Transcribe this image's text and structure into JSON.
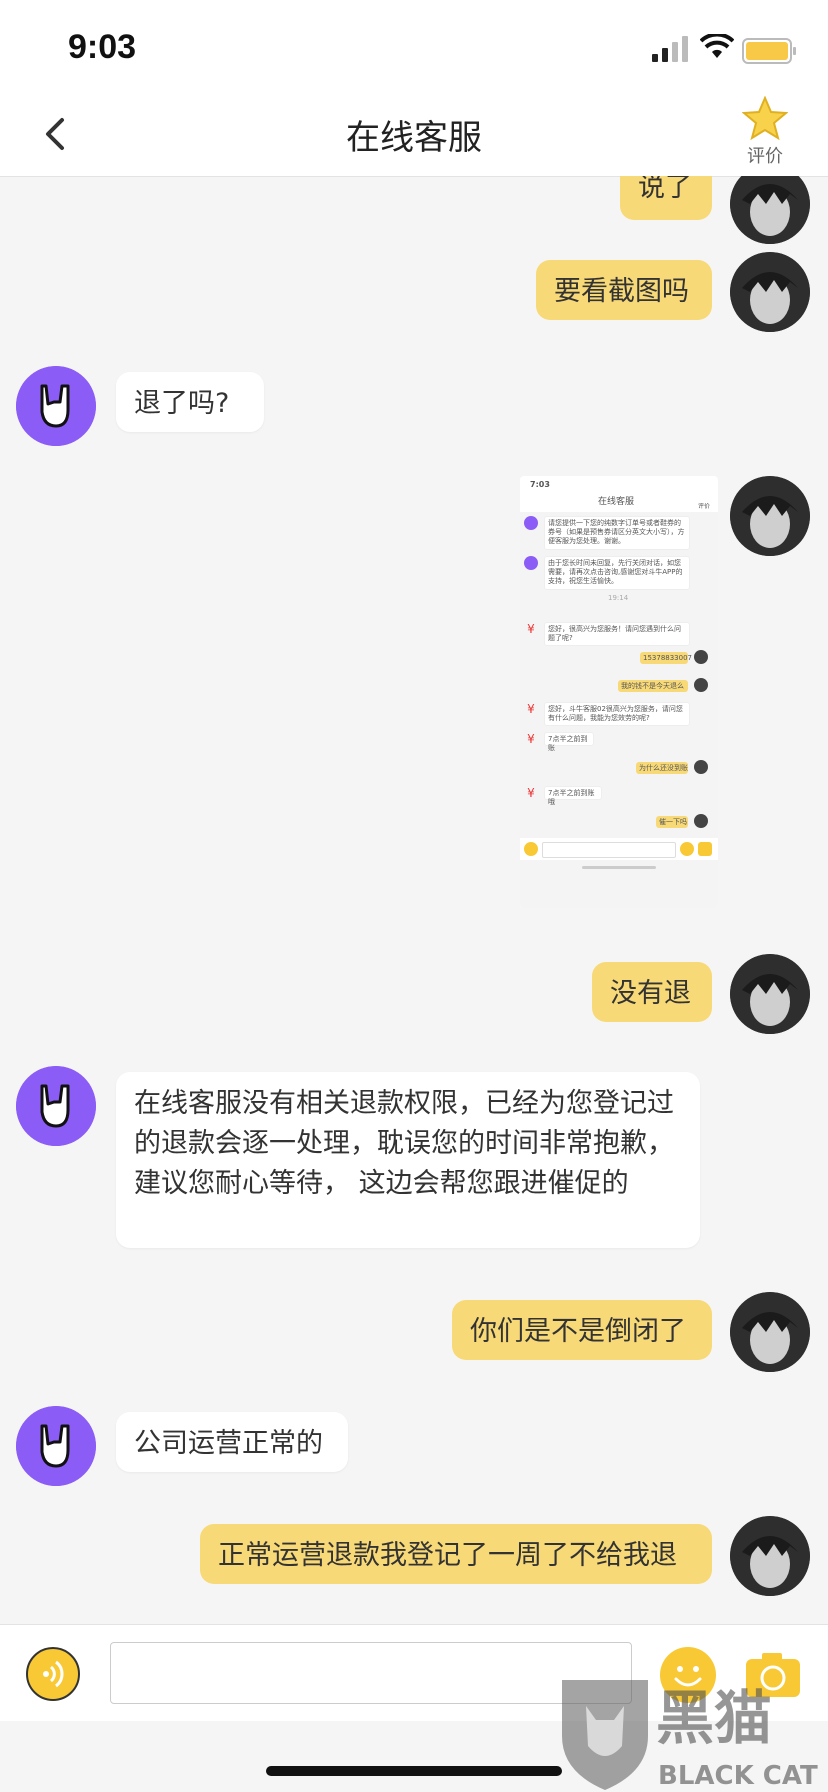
{
  "status_bar": {
    "time": "9:03"
  },
  "header": {
    "title": "在线客服",
    "rate_label": "评价"
  },
  "messages": [
    {
      "side": "user",
      "text": "说了"
    },
    {
      "side": "user",
      "text": "要看截图吗"
    },
    {
      "side": "agent",
      "text": "退了吗?"
    },
    {
      "side": "user",
      "type": "image"
    },
    {
      "side": "user",
      "text": "没有退"
    },
    {
      "side": "agent",
      "text": "在线客服没有相关退款权限，已经为您登记过的退款会逐一处理，耽误您的时间非常抱歉，建议您耐心等待， 这边会帮您跟进催促的"
    },
    {
      "side": "user",
      "text": "你们是不是倒闭了"
    },
    {
      "side": "agent",
      "text": "公司运营正常的"
    },
    {
      "side": "user",
      "text": "正常运营退款我登记了一周了不给我退"
    }
  ],
  "screenshot_thumb": {
    "time": "7:03",
    "title": "在线客服",
    "rate": "评价",
    "time_divider": "19:14",
    "lines": [
      "请您提供一下您的纯数字订单号或者鞋券的券号（如果是预售券请区分英文大小写），方便客服为您处理。谢谢。",
      "由于您长时间未回复，先行关闭对话，如您需要，请再次点击咨询,感谢您对斗牛APP的支持，祝您生活愉快。",
      "您好，很高兴为您服务！请问您遇到什么问题了呢?",
      "15378833007",
      "我的钱不是今天退么",
      "您好，斗牛客服02很高兴为您服务，请问您有什么问题，我能为您效劳的呢?",
      "7点半之前到账",
      "为什么还没到账",
      "7点半之前到账哦",
      "催一下吗"
    ]
  },
  "input_bar": {
    "placeholder": ""
  },
  "watermark": {
    "cn": "黑猫",
    "en": "BLACK CAT"
  },
  "colors": {
    "user_bubble": "#f8d977",
    "agent_avatar": "#8b5cf6",
    "accent": "#f8c935"
  }
}
